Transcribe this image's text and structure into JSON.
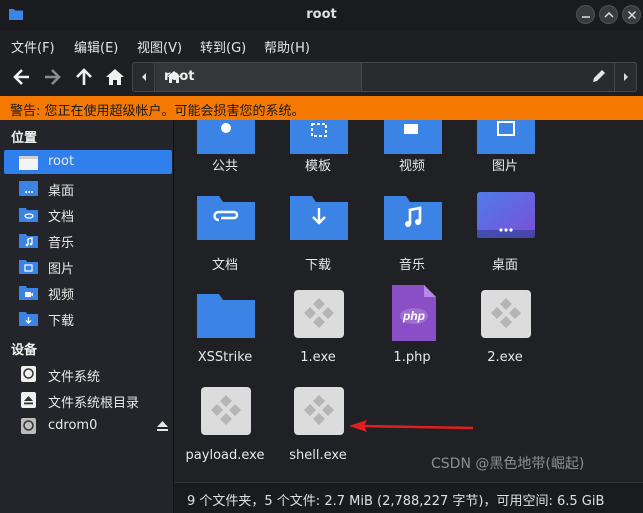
{
  "window": {
    "title": "root"
  },
  "menu": [
    "文件(F)",
    "编辑(E)",
    "视图(V)",
    "转到(G)",
    "帮助(H)"
  ],
  "path": {
    "crumb": "root"
  },
  "warning": "警告: 您正在使用超级帐户。可能会损害您的系统。",
  "sidebar": {
    "places_header": "位置",
    "places": [
      {
        "label": "root",
        "icon": "home-folder-icon",
        "active": true
      },
      {
        "label": "桌面",
        "icon": "desktop-folder-icon"
      },
      {
        "label": "文档",
        "icon": "documents-folder-icon"
      },
      {
        "label": "音乐",
        "icon": "music-folder-icon"
      },
      {
        "label": "图片",
        "icon": "pictures-folder-icon"
      },
      {
        "label": "视频",
        "icon": "videos-folder-icon"
      },
      {
        "label": "下载",
        "icon": "downloads-folder-icon"
      }
    ],
    "devices_header": "设备",
    "devices": [
      {
        "label": "文件系统",
        "icon": "drive-icon"
      },
      {
        "label": "文件系统根目录",
        "icon": "eject-icon"
      },
      {
        "label": "cdrom0",
        "icon": "optical-drive-icon"
      }
    ]
  },
  "files": [
    {
      "label": "公共",
      "icon": "public-folder-icon"
    },
    {
      "label": "模板",
      "icon": "templates-folder-icon"
    },
    {
      "label": "视频",
      "icon": "videos-folder-icon"
    },
    {
      "label": "图片",
      "icon": "pictures-folder-icon"
    },
    {
      "label": "文档",
      "icon": "documents-folder-icon"
    },
    {
      "label": "下载",
      "icon": "downloads-folder-icon"
    },
    {
      "label": "音乐",
      "icon": "music-folder-icon"
    },
    {
      "label": "桌面",
      "icon": "desktop-folder-icon"
    },
    {
      "label": "XSStrike",
      "icon": "folder-icon"
    },
    {
      "label": "1.exe",
      "icon": "executable-icon"
    },
    {
      "label": "1.php",
      "icon": "php-file-icon"
    },
    {
      "label": "2.exe",
      "icon": "executable-icon"
    },
    {
      "label": "payload.exe",
      "icon": "executable-icon"
    },
    {
      "label": "shell.exe",
      "icon": "executable-icon"
    }
  ],
  "status": "9 个文件夹，5 个文件: 2.7 MiB (2,788,227 字节)，可用空间: 6.5 GiB",
  "watermark": "CSDN @黑色地带(崛起)",
  "colors": {
    "accent": "#2f80ed",
    "warning": "#f57900",
    "folder": "#3b84e6",
    "annotation_arrow": "#e02020"
  }
}
